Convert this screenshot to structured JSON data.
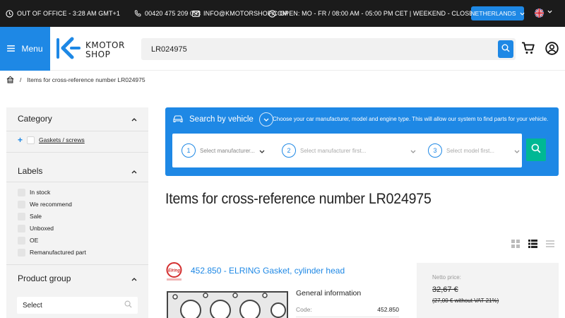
{
  "topbar": {
    "office_status": "OUT OF OFFICE - 3:28 AM GMT+1",
    "phone": "00420 475 209 033",
    "email": "INFO@KMOTORSHOP.COM",
    "hours": "OPEN: MO - FR / 08:00 AM - 05:00 PM CET | WEEKEND - CLOSED",
    "country": "NETHERLANDS"
  },
  "header": {
    "menu_label": "Menu",
    "logo_line1": "KMOTOR",
    "logo_line2": "SHOP",
    "search_value": "LR024975"
  },
  "breadcrumb": {
    "current": "Items for cross-reference number LR024975",
    "separator": "/"
  },
  "sidebar": {
    "category": {
      "title": "Category",
      "items": [
        {
          "label": "Gaskets / screws"
        }
      ]
    },
    "labels": {
      "title": "Labels",
      "items": [
        {
          "label": "In stock"
        },
        {
          "label": "We recommend"
        },
        {
          "label": "Sale"
        },
        {
          "label": "Unboxed"
        },
        {
          "label": "OE"
        },
        {
          "label": "Remanufactured part"
        }
      ]
    },
    "product_group": {
      "title": "Product group",
      "select_value": "Select"
    }
  },
  "vehicle_search": {
    "title": "Search by vehicle",
    "description": "Choose your car manufacturer, model and engine type. This will allow our system to find parts for your vehicle.",
    "steps": [
      {
        "num": "1",
        "text": "Select manufacturer..."
      },
      {
        "num": "2",
        "text": "Select manufacturer first..."
      },
      {
        "num": "3",
        "text": "Select model first..."
      }
    ]
  },
  "page": {
    "title": "Items for cross-reference number LR024975"
  },
  "product": {
    "brand": "ELRING",
    "title": "452.850 - ELRING Gasket, cylinder head",
    "general_info": "General information",
    "code_label": "Code:",
    "code_value": "452.850",
    "netto_label": "Netto price:",
    "price_old": "32,67 €",
    "price_vat": "(27,00 € without VAT 21%)"
  },
  "colors": {
    "accent": "#1e88e5",
    "topbar": "#1b1b1b",
    "go_button": "#00b894",
    "sidebar_bg": "#f3f3f3"
  }
}
